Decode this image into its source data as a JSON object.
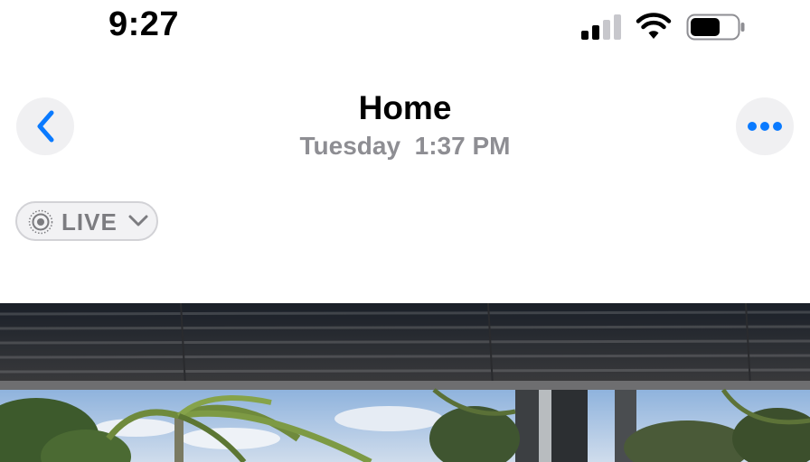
{
  "status_bar": {
    "time": "9:27",
    "signal_icon": "cellular-signal-icon",
    "wifi_icon": "wifi-icon",
    "battery_icon": "battery-icon"
  },
  "header": {
    "title": "Home",
    "day": "Tuesday",
    "time": "1:37 PM",
    "back_icon": "chevron-left-icon",
    "more_icon": "ellipsis-icon"
  },
  "live_badge": {
    "label": "LIVE",
    "icon": "live-photo-icon",
    "chevron_icon": "chevron-down-icon"
  },
  "photo": {
    "subject": "photo-image"
  },
  "colors": {
    "accent": "#0a7aff",
    "secondary_text": "#8e8e93",
    "button_bg": "#f0f0f2"
  }
}
